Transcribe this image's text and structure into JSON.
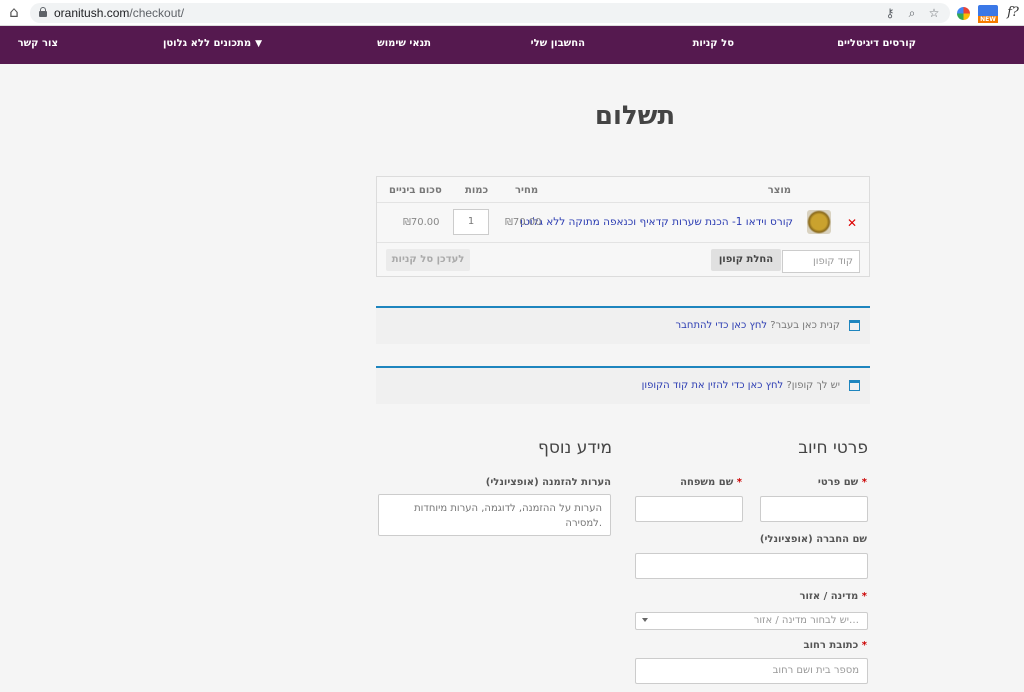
{
  "browser": {
    "url_domain": "oranitush.com",
    "url_path": "/checkout/"
  },
  "nav": {
    "items": [
      "קורסים דיגיטליים",
      "סל קניות",
      "החשבון שלי",
      "תנאי שימוש",
      "מתכונים ללא גלוטן",
      "צור קשר"
    ]
  },
  "page": {
    "title": "תשלום"
  },
  "cart": {
    "headers": {
      "product": "מוצר",
      "price": "מחיר",
      "quantity": "כמות",
      "subtotal": "סכום ביניים"
    },
    "item": {
      "name": "קורס וידאו 1- הכנת שערות קדאיף וכנאפה מתוקה ללא גלוטן",
      "price": "₪70.00",
      "quantity": "1",
      "subtotal": "₪70.00"
    },
    "coupon_placeholder": "קוד קופון",
    "apply_coupon": "החלת קופון",
    "update_cart": "לעדכן סל קניות"
  },
  "notices": {
    "login": {
      "text": "קנית כאן בעבר?",
      "link": "לחץ כאן כדי להתחבר"
    },
    "coupon": {
      "text": "יש לך קופון?",
      "link": "לחץ כאן כדי להזין את קוד הקופון"
    }
  },
  "billing": {
    "heading": "פרטי חיוב",
    "first_name": "שם פרטי",
    "last_name": "שם משפחה",
    "company": "שם החברה (אופציונלי)",
    "country": "מדינה / אזור",
    "country_placeholder": "יש לבחור מדינה / אזור…",
    "street": "כתובת רחוב",
    "street_placeholder": "מספר בית ושם רחוב"
  },
  "additional": {
    "heading": "מידע נוסף",
    "notes_label": "הערות להזמנה (אופציונלי)",
    "notes_placeholder": "הערות על ההזמנה, לדוגמה, הערות מיוחדות למסירה."
  },
  "required_mark": "*",
  "colors": {
    "nav": "#55194f",
    "link": "#2a3bb2",
    "notice_border": "#1e85be"
  }
}
